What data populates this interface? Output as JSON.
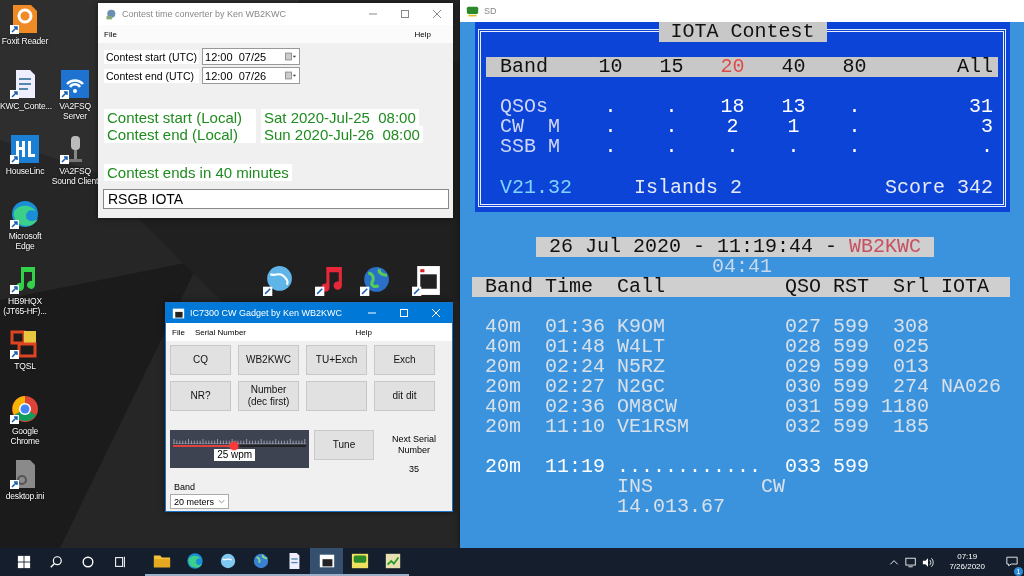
{
  "desktop_icons": [
    {
      "label": "Foxit Reader"
    },
    {
      "label": "KWC_Conte..."
    },
    {
      "label": "VA2FSQ Server"
    },
    {
      "label": "HouseLinc"
    },
    {
      "label": "VA2FSQ Sound Client"
    },
    {
      "label": "Microsoft Edge"
    },
    {
      "label": "HB9HQX (JT65-HF)..."
    },
    {
      "label": "TQSL"
    },
    {
      "label": "Google Chrome"
    },
    {
      "label": "desktop.ini"
    }
  ],
  "converter": {
    "title": "Contest time converter by Ken WB2KWC",
    "menu": [
      "File",
      "Help"
    ],
    "utc_fields": [
      {
        "label": "Contest start (UTC)",
        "value": "12:00  07/25"
      },
      {
        "label": "Contest end (UTC)",
        "value": "12:00  07/26"
      }
    ],
    "local_times": [
      {
        "label": "Contest start (Local)",
        "value": "Sat 2020-Jul-25  08:00"
      },
      {
        "label": "Contest end (Local)",
        "value": "Sun 2020-Jul-26  08:00"
      }
    ],
    "countdown": "Contest ends in 40 minutes",
    "contest_name": "RSGB IOTA"
  },
  "cw_gadget": {
    "title": "IC7300 CW Gadget by Ken WB2KWC",
    "menu": [
      "File",
      "Serial Number",
      "Help"
    ],
    "macro_buttons": [
      {
        "kind": "macro",
        "label": "CQ"
      },
      {
        "kind": "macro",
        "label": "WB2KWC"
      },
      {
        "kind": "macro",
        "label": "TU+Exch"
      },
      {
        "kind": "macro",
        "label": "Exch"
      },
      {
        "kind": "macro",
        "label": "NR?"
      },
      {
        "kind": "macro",
        "label": "Number\n(dec first)"
      },
      {
        "kind": "blank"
      },
      {
        "kind": "macro",
        "label": "dit dit"
      }
    ],
    "speed": {
      "level": 0.46,
      "reading": "25 wpm"
    },
    "tune_button": "Tune",
    "next_serial": {
      "label": "Next Serial Number",
      "value": "35"
    },
    "band": {
      "label": "Band",
      "value": "20 meters"
    }
  },
  "sd": {
    "title": "SD",
    "summary": {
      "title": "IOTA Contest",
      "header_label": "Band",
      "band_columns": [
        {
          "label": "10",
          "selected": false
        },
        {
          "label": "15",
          "selected": false
        },
        {
          "label": "20",
          "selected": true
        },
        {
          "label": "40",
          "selected": false
        },
        {
          "label": "80",
          "selected": false
        }
      ],
      "total_label": "All",
      "rows": [
        {
          "label": "QSOs",
          "values": [
            ".",
            ".",
            "18",
            "13",
            "."
          ],
          "total": "31"
        },
        {
          "label": "CW  M",
          "values": [
            ".",
            ".",
            "2",
            "1",
            "."
          ],
          "total": "3"
        },
        {
          "label": "SSB M",
          "values": [
            ".",
            ".",
            ".",
            ".",
            "."
          ],
          "total": "."
        }
      ],
      "version": "V21.32",
      "islands": "Islands 2",
      "score": "Score 342"
    },
    "log": {
      "clock": "26 Jul 2020 - 11:19:44 -",
      "callsign": "WB2KWC",
      "timer": "04:41",
      "columns": [
        "Band",
        "Time",
        "Call",
        "QSO",
        "RST",
        "Srl",
        "IOTA"
      ],
      "rows": [
        [
          "40m",
          "01:36",
          "K9OM",
          "027",
          "599",
          "308"
        ],
        [
          "40m",
          "01:48",
          "W4LT",
          "028",
          "599",
          "025"
        ],
        [
          "20m",
          "02:24",
          "N5RZ",
          "029",
          "599",
          "013"
        ],
        [
          "20m",
          "02:27",
          "N2GC",
          "030",
          "599",
          "274",
          "NA026"
        ],
        [
          "40m",
          "02:36",
          "OM8CW",
          "031",
          "599",
          "1180"
        ],
        [
          "20m",
          "11:10",
          "VE1RSM",
          "032",
          "599",
          "185"
        ]
      ],
      "entry": {
        "band": "20m",
        "time": "11:19",
        "call": "............",
        "qso": "033",
        "rst": "599",
        "mode_label": "INS",
        "mode": "CW",
        "frequency": "14.013.67"
      }
    }
  },
  "taskbar": {
    "apps": [
      {
        "running": true,
        "selected": false
      },
      {
        "running": true,
        "selected": false
      },
      {
        "running": true,
        "selected": false
      },
      {
        "running": true,
        "selected": false
      },
      {
        "running": true,
        "selected": false
      },
      {
        "running": true,
        "selected": true
      },
      {
        "running": true,
        "selected": false
      },
      {
        "running": true,
        "selected": false
      }
    ],
    "time": "07:19",
    "date": "7/26/2020",
    "notifications": "1"
  }
}
